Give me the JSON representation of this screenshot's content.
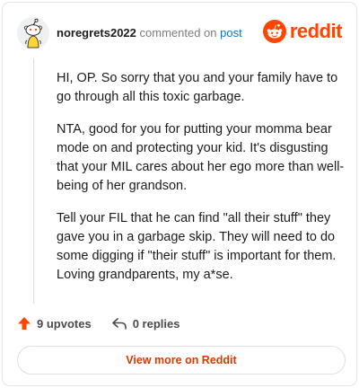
{
  "comment": {
    "username": "noregrets2022",
    "action": "commented on",
    "post_link": "post",
    "paragraphs": [
      "HI, OP. So sorry that you and your family have to go through all this toxic garbage.",
      "NTA, good for you for putting your momma bear mode on and protecting your kid. It's disgusting that your MIL cares about her ego more than well-being of her grandson.",
      "Tell your FIL that he can find \"all their stuff\" they gave you in a garbage skip. They will need to do some digging if \"their stuff\" is important for them. Loving grandparents, my a*se."
    ],
    "upvotes": "9 upvotes",
    "replies": "0 replies"
  },
  "brand": {
    "name": "reddit",
    "color": "#ff4500"
  },
  "footer": {
    "view_more": "View more on Reddit"
  },
  "icons": {
    "avatar": "snoo-avatar",
    "brand": "reddit-alien-icon",
    "upvote": "upvote-arrow-icon",
    "reply": "reply-arrow-icon"
  }
}
